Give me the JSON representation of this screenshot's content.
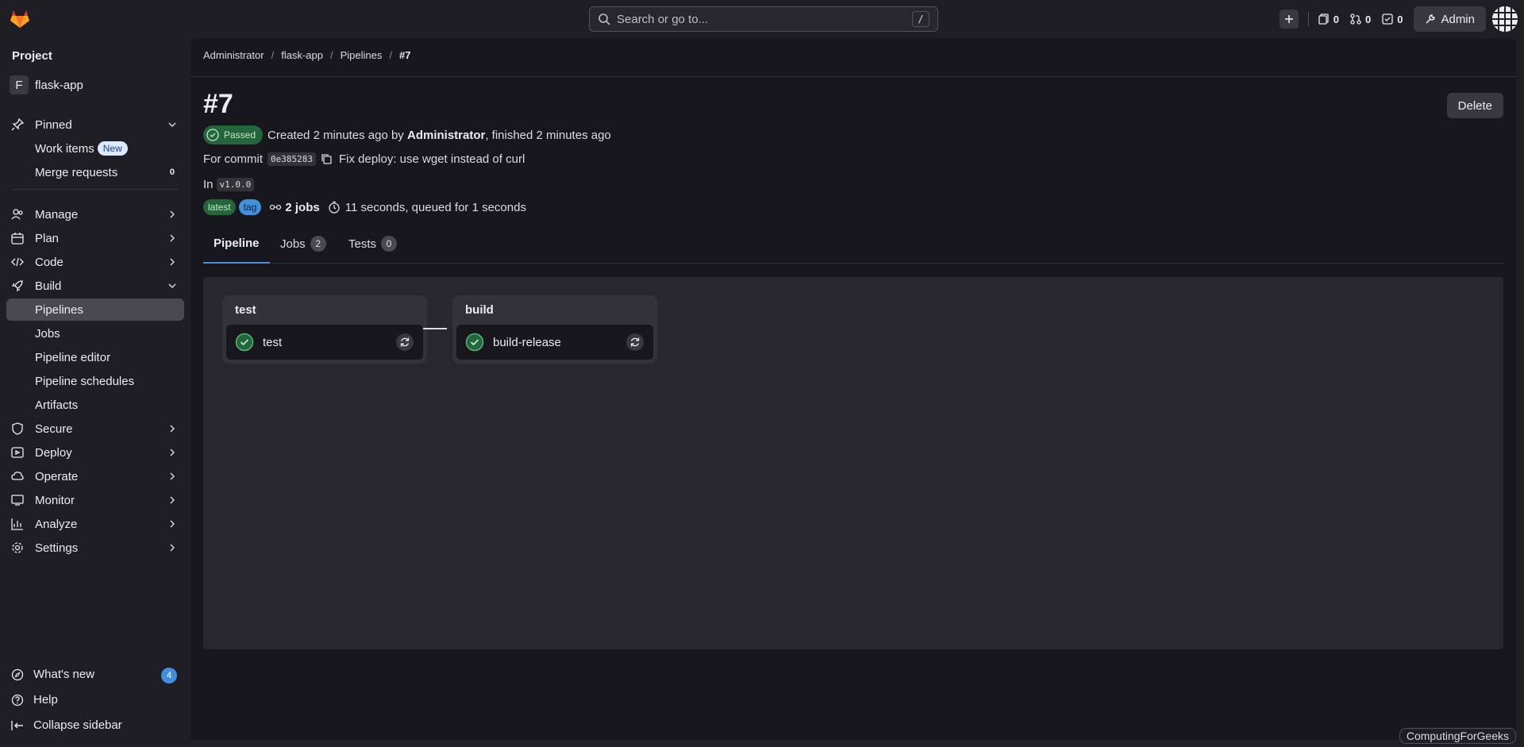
{
  "topbar": {
    "search_placeholder": "Search or go to...",
    "search_shortcut": "/",
    "issues_count": "0",
    "merge_requests_count": "0",
    "todos_count": "0",
    "admin_label": "Admin"
  },
  "sidebar": {
    "heading": "Project",
    "project_initial": "F",
    "project_name": "flask-app",
    "pinned": "Pinned",
    "work_items": "Work items",
    "new_badge": "New",
    "merge_requests": "Merge requests",
    "merge_requests_count": "0",
    "manage": "Manage",
    "plan": "Plan",
    "code": "Code",
    "build": "Build",
    "pipelines": "Pipelines",
    "jobs": "Jobs",
    "pipeline_editor": "Pipeline editor",
    "pipeline_schedules": "Pipeline schedules",
    "artifacts": "Artifacts",
    "secure": "Secure",
    "deploy": "Deploy",
    "operate": "Operate",
    "monitor": "Monitor",
    "analyze": "Analyze",
    "settings": "Settings",
    "whats_new": "What's new",
    "whats_new_count": "4",
    "help": "Help",
    "collapse": "Collapse sidebar"
  },
  "breadcrumb": [
    "Administrator",
    "flask-app",
    "Pipelines",
    "#7"
  ],
  "pipeline": {
    "title": "#7",
    "delete_label": "Delete",
    "status": "Passed",
    "created_prefix": "Created 2 minutes ago by",
    "author": "Administrator",
    "finished": ", finished 2 minutes ago",
    "for_commit": "For commit",
    "commit_sha": "0e385283",
    "commit_message": "Fix deploy: use wget instead of curl",
    "in_label": "In",
    "ref": "v1.0.0",
    "badge_latest": "latest",
    "badge_tag": "tag",
    "jobs_summary": "2 jobs",
    "duration": "11 seconds, queued for 1 seconds"
  },
  "tabs": {
    "pipeline": "Pipeline",
    "jobs": "Jobs",
    "jobs_count": "2",
    "tests": "Tests",
    "tests_count": "0"
  },
  "graph": {
    "stages": [
      {
        "name": "test",
        "job": "test"
      },
      {
        "name": "build",
        "job": "build-release"
      }
    ]
  },
  "watermark": "ComputingForGeeks",
  "colors": {
    "success": "#108548",
    "link": "#428fdc",
    "background": "#18171d",
    "sidebar": "#1f1e24"
  }
}
